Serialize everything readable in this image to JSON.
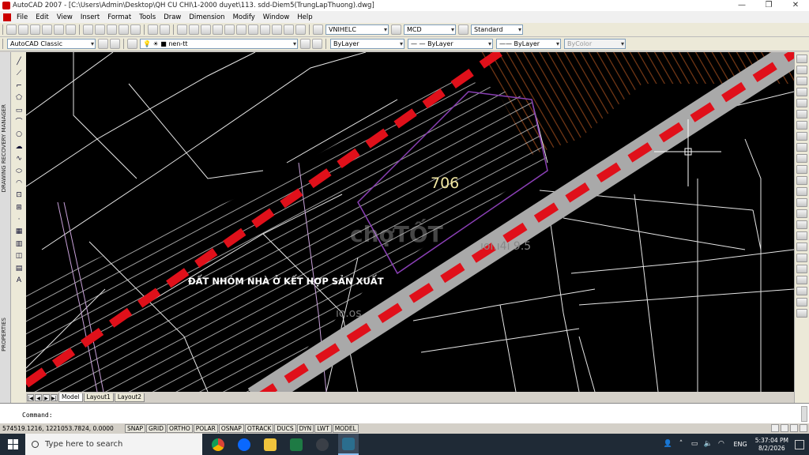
{
  "window": {
    "title": "AutoCAD 2007 - [C:\\Users\\Admin\\Desktop\\QH CU CHI\\1-2000 duyet\\113. sdd-Diem5(TrungLapThuong).dwg]",
    "minimize": "—",
    "maximize": "❐",
    "close": "✕"
  },
  "menu": [
    "File",
    "Edit",
    "View",
    "Insert",
    "Format",
    "Tools",
    "Draw",
    "Dimension",
    "Modify",
    "Window",
    "Help"
  ],
  "toolbar": {
    "text_style": "VNIHELC",
    "dim_style": "MCD",
    "table_style": "Standard",
    "workspace": "AutoCAD Classic",
    "layer": "nen-tt",
    "color": "ByLayer",
    "linetype": "ByLayer",
    "lineweight": "ByLayer",
    "plotstyle": "ByColor"
  },
  "palettes": {
    "drawing_recovery": "DRAWING RECOVERY MANAGER",
    "properties": "PROPERTIES"
  },
  "drawing": {
    "parcel_number": "706",
    "zone_label": "ĐẤT NHÓM NHÀ Ở KẾT HỢP SẢN XUẤT",
    "watermark": "chợTỐT",
    "road_colors": {
      "road": "#a9a9a9",
      "dash": "#e0101a",
      "hatch": "#c8c8c8",
      "boundary": "#8a3fb5"
    }
  },
  "layout_tabs": [
    "Model",
    "Layout1",
    "Layout2"
  ],
  "command": {
    "prompt": "Command:"
  },
  "status": {
    "coords": "574519.1216, 1221053.7824, 0.0000",
    "toggles": [
      "SNAP",
      "GRID",
      "ORTHO",
      "POLAR",
      "OSNAP",
      "OTRACK",
      "DUCS",
      "DYN",
      "LWT",
      "MODEL"
    ]
  },
  "taskbar": {
    "search_placeholder": "Type here to search",
    "language": "ENG",
    "time": "5:37:04 PM",
    "date": "8/2/2026"
  }
}
